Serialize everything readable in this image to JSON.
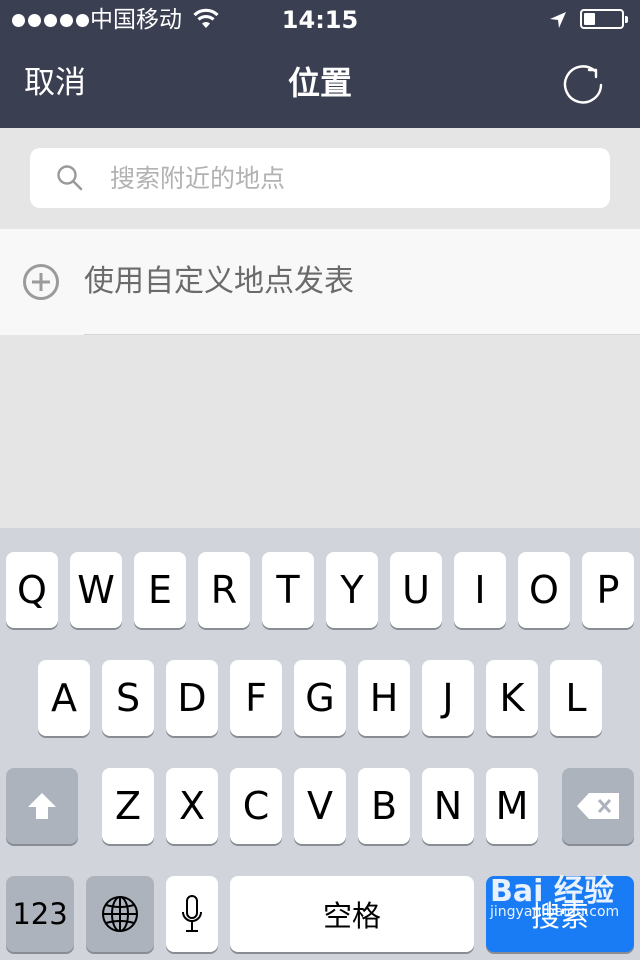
{
  "status_bar": {
    "carrier": "中国移动",
    "time": "14:15",
    "signal_bars": 5,
    "battery_level": 0.3
  },
  "nav": {
    "cancel_label": "取消",
    "title": "位置",
    "refresh_icon": "refresh-icon"
  },
  "search": {
    "placeholder": "搜索附近的地点",
    "value": ""
  },
  "custom_location": {
    "label": "使用自定义地点发表",
    "icon": "plus-circle-icon"
  },
  "keyboard": {
    "row1": [
      "Q",
      "W",
      "E",
      "R",
      "T",
      "Y",
      "U",
      "I",
      "O",
      "P"
    ],
    "row2": [
      "A",
      "S",
      "D",
      "F",
      "G",
      "H",
      "J",
      "K",
      "L"
    ],
    "row3": [
      "Z",
      "X",
      "C",
      "V",
      "B",
      "N",
      "M"
    ],
    "numbers_label": "123",
    "space_label": "空格",
    "search_label": "搜索",
    "shift_icon": "shift-icon",
    "globe_icon": "globe-icon",
    "mic_icon": "microphone-icon",
    "delete_icon": "backspace-icon",
    "search_key_color": "#1a7cf5"
  },
  "watermark": {
    "logo": "Bai 经验",
    "url": "jingyan.baidu.com"
  }
}
